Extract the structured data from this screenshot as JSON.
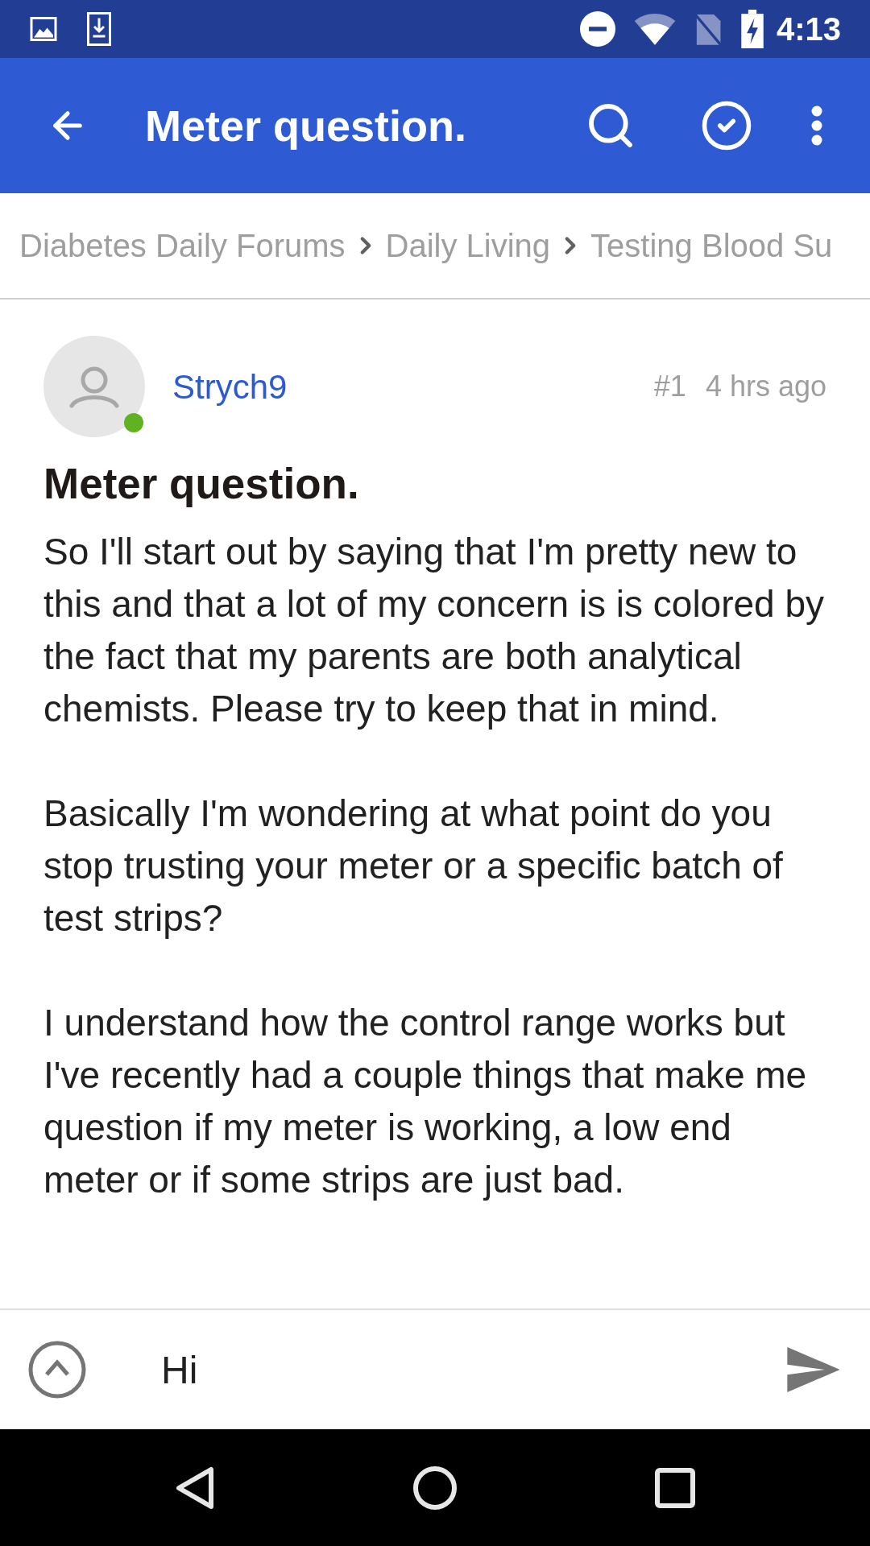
{
  "status_bar": {
    "time": "4:13"
  },
  "app_bar": {
    "title": "Meter question."
  },
  "breadcrumb": [
    {
      "label": "Diabetes Daily Forums"
    },
    {
      "label": "Daily Living"
    },
    {
      "label": "Testing Blood Su"
    }
  ],
  "post": {
    "author": "Strych9",
    "online": true,
    "number": "#1",
    "time": "4 hrs ago",
    "title": "Meter question.",
    "paragraphs": [
      "So I'll start out by saying that I'm pretty new to this and that a lot of my concern is is colored by the fact that my parents are both analytical chemists. Please try to keep that in mind.",
      "Basically I'm wondering at what point do you stop trusting your meter or a specific batch of test strips?",
      "I understand how the control range works but I've recently had a couple things that make me question if my meter is working, a low end meter or if some strips are just bad."
    ]
  },
  "composer": {
    "value": "Hi"
  }
}
